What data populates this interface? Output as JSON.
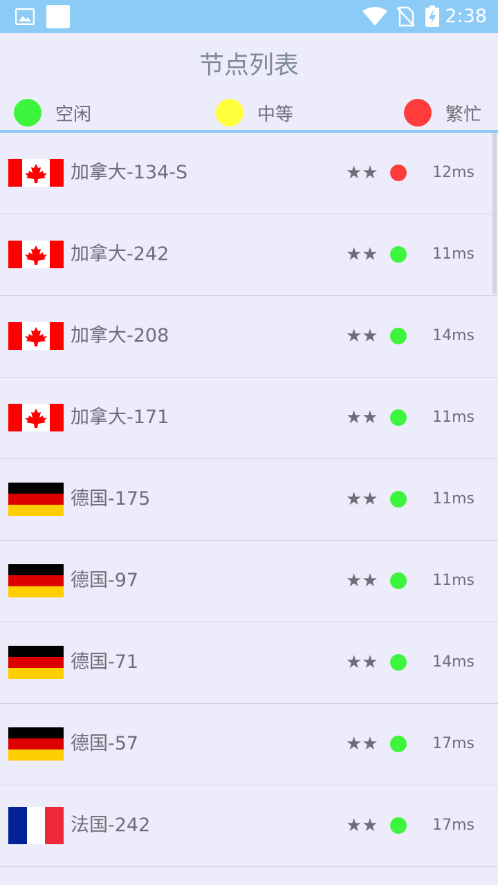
{
  "status_bar": {
    "time": "2:38",
    "icons": [
      "image-icon",
      "square-icon",
      "wifi-icon",
      "no-sim-icon",
      "battery-charging-icon"
    ]
  },
  "header": {
    "title": "节点列表"
  },
  "legend": [
    {
      "label": "空闲",
      "color": "#3CF53C"
    },
    {
      "label": "中等",
      "color": "#FFFF3C"
    },
    {
      "label": "繁忙",
      "color": "#FF3C3C"
    }
  ],
  "nodes": [
    {
      "flag": "canada-flag-icon",
      "name": "加拿大-134-S",
      "stars": "★★",
      "status": "busy",
      "status_color": "#FF3C3C",
      "ping": "12ms"
    },
    {
      "flag": "canada-flag-icon",
      "name": "加拿大-242",
      "stars": "★★",
      "status": "idle",
      "status_color": "#3CF53C",
      "ping": "11ms"
    },
    {
      "flag": "canada-flag-icon",
      "name": "加拿大-208",
      "stars": "★★",
      "status": "idle",
      "status_color": "#3CF53C",
      "ping": "14ms"
    },
    {
      "flag": "canada-flag-icon",
      "name": "加拿大-171",
      "stars": "★★",
      "status": "idle",
      "status_color": "#3CF53C",
      "ping": "11ms"
    },
    {
      "flag": "germany-flag-icon",
      "name": "德国-175",
      "stars": "★★",
      "status": "idle",
      "status_color": "#3CF53C",
      "ping": "11ms"
    },
    {
      "flag": "germany-flag-icon",
      "name": "德国-97",
      "stars": "★★",
      "status": "idle",
      "status_color": "#3CF53C",
      "ping": "11ms"
    },
    {
      "flag": "germany-flag-icon",
      "name": "德国-71",
      "stars": "★★",
      "status": "idle",
      "status_color": "#3CF53C",
      "ping": "14ms"
    },
    {
      "flag": "germany-flag-icon",
      "name": "德国-57",
      "stars": "★★",
      "status": "idle",
      "status_color": "#3CF53C",
      "ping": "17ms"
    },
    {
      "flag": "france-flag-icon",
      "name": "法国-242",
      "stars": "★★",
      "status": "idle",
      "status_color": "#3CF53C",
      "ping": "17ms"
    }
  ],
  "colors": {
    "status_bar": "#8DCBF7",
    "background": "#ECECFB",
    "text": "#6E6E78",
    "title": "#7E8A98"
  }
}
